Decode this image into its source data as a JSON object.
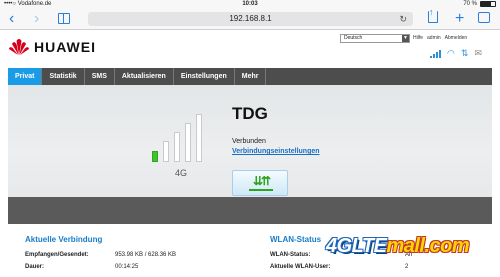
{
  "status_bar": {
    "carrier": "••••○ Vodafone.de",
    "time": "10:03",
    "battery_text": "70 %",
    "battery_level": 0.7
  },
  "browser": {
    "back_icon": "‹",
    "forward_icon": "›",
    "url": "192.168.8.1",
    "reload_icon": "↻",
    "add_icon": "+"
  },
  "header": {
    "brand": "HUAWEI",
    "language": "Deutsch",
    "links": [
      "Hilfe",
      "admin",
      "Abmelden"
    ],
    "wifi_icon": "◠",
    "transfer_icon": "⇅",
    "mail_icon": "✉"
  },
  "nav": {
    "tabs": [
      "Privat",
      "Statistik",
      "SMS",
      "Aktualisieren",
      "Einstellungen",
      "Mehr"
    ],
    "active_tab": "Privat"
  },
  "hero": {
    "signal_bars_on": 1,
    "signal_bars_total": 5,
    "network_type": "4G",
    "provider": "TDG",
    "connection_status": "Verbunden",
    "settings_link": "Verbindungseinstellungen",
    "connect_icon": "⇊⇈"
  },
  "connection": {
    "title": "Aktuelle Verbindung",
    "rows": [
      {
        "label": "Empfangen/Gesendet:",
        "value": "953.98 KB  /  628.36 KB"
      },
      {
        "label": "Dauer:",
        "value": "00:14:25"
      }
    ]
  },
  "wlan": {
    "title": "WLAN-Status",
    "rows": [
      {
        "label": "WLAN-Status:",
        "value": "An"
      },
      {
        "label": "Aktuelle WLAN-User:",
        "value": "2"
      }
    ]
  },
  "watermark": {
    "prefix": "4GLTE",
    "suffix": "mall.com"
  },
  "colors": {
    "nav_bg": "#4d4d4d",
    "nav_active": "#1a9be8",
    "signal_on": "#3ec22e",
    "link_blue": "#1a6fc4",
    "section_title": "#1a7cc9"
  }
}
